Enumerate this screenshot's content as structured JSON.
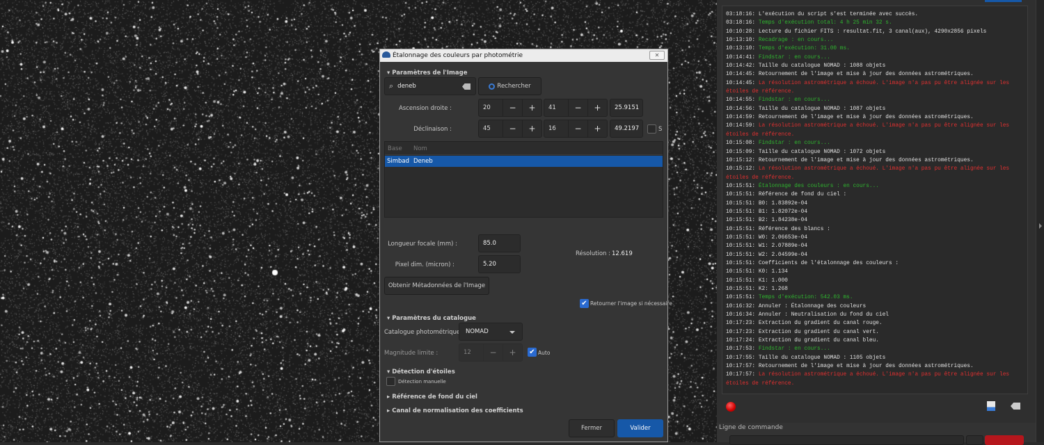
{
  "dialog": {
    "title": "Étalonnage des couleurs par photométrie",
    "close_label": "✕",
    "sec_image": "Paramètres de l'Image",
    "search_value": "deneb",
    "search_button": "Rechercher",
    "ra_label": "Ascension droite :",
    "ra": [
      "20",
      "41",
      "25.9151"
    ],
    "dec_label": "Déclinaison :",
    "dec": [
      "45",
      "16",
      "49.2197"
    ],
    "south_label": "S",
    "south_checked": false,
    "table_headers": [
      "Base",
      "Nom"
    ],
    "table_rows": [
      [
        "Simbad",
        "Deneb"
      ]
    ],
    "focal_label": "Longueur focale (mm) :",
    "focal_value": "85.0",
    "pixel_label": "Pixel dim. (micron) :",
    "pixel_value": "5.20",
    "resolution_label": "Résolution :",
    "resolution_value": "12.619",
    "metadata_button": "Obtenir Métadonnées de l'Image",
    "flip_label": "Retourner l'image si nécessaire",
    "flip_checked": true,
    "sec_catalogue": "Paramètres du catalogue",
    "catalogue_label": "Catalogue photométrique :",
    "catalogue_value": "NOMAD",
    "maglim_label": "Magnitude limite :",
    "maglim_value": "12",
    "auto_label": "Auto",
    "auto_checked": true,
    "sec_detection": "Détection d'étoiles",
    "manual_label": "Détection manuelle",
    "manual_checked": false,
    "sec_background": "Référence de fond du ciel",
    "sec_norm": "Canal de normalisation des coefficients",
    "close_button": "Fermer",
    "apply_button": "Valider"
  },
  "log": [
    {
      "time": "03:18:16:",
      "msg": "L'exécution du script s'est terminée avec succès.",
      "type": "info"
    },
    {
      "time": "03:18:16:",
      "msg": "Temps d'exécution total: 4 h 25 min 32 s.",
      "type": "ok"
    },
    {
      "time": "10:10:28:",
      "msg": "Lecture du fichier FITS : resultat.fit, 3 canal(aux), 4290x2856 pixels",
      "type": "info"
    },
    {
      "time": "10:13:10:",
      "msg": "Recadrage : en cours...",
      "type": "ok"
    },
    {
      "time": "10:13:10:",
      "msg": "Temps d'exécution: 31.00 ms.",
      "type": "ok"
    },
    {
      "time": "10:14:41:",
      "msg": "Findstar : en cours...",
      "type": "ok"
    },
    {
      "time": "10:14:42:",
      "msg": "Taille du catalogue NOMAD : 1088 objets",
      "type": "info"
    },
    {
      "time": "10:14:45:",
      "msg": "Retournement de l'image et mise à jour des données astrométriques.",
      "type": "info"
    },
    {
      "time": "10:14:45:",
      "msg": "La résolution astrométrique a échoué. L'image n'a pas pu être alignée sur les étoiles de référence.",
      "type": "err"
    },
    {
      "time": "10:14:55:",
      "msg": "Findstar : en cours...",
      "type": "ok"
    },
    {
      "time": "10:14:56:",
      "msg": "Taille du catalogue NOMAD : 1087 objets",
      "type": "info"
    },
    {
      "time": "10:14:59:",
      "msg": "Retournement de l'image et mise à jour des données astrométriques.",
      "type": "info"
    },
    {
      "time": "10:14:59:",
      "msg": "La résolution astrométrique a échoué. L'image n'a pas pu être alignée sur les étoiles de référence.",
      "type": "err"
    },
    {
      "time": "10:15:08:",
      "msg": "Findstar : en cours...",
      "type": "ok"
    },
    {
      "time": "10:15:09:",
      "msg": "Taille du catalogue NOMAD : 1072 objets",
      "type": "info"
    },
    {
      "time": "10:15:12:",
      "msg": "Retournement de l'image et mise à jour des données astrométriques.",
      "type": "info"
    },
    {
      "time": "10:15:12:",
      "msg": "La résolution astrométrique a échoué. L'image n'a pas pu être alignée sur les étoiles de référence.",
      "type": "err"
    },
    {
      "time": "10:15:51:",
      "msg": "Étalonnage des couleurs : en cours...",
      "type": "ok"
    },
    {
      "time": "10:15:51:",
      "msg": "Référence de fond du ciel :",
      "type": "info"
    },
    {
      "time": "10:15:51:",
      "msg": "B0: 1.83892e-04",
      "type": "info"
    },
    {
      "time": "10:15:51:",
      "msg": "B1: 1.82072e-04",
      "type": "info"
    },
    {
      "time": "10:15:51:",
      "msg": "B2: 1.84238e-04",
      "type": "info"
    },
    {
      "time": "10:15:51:",
      "msg": "Référence des blancs :",
      "type": "info"
    },
    {
      "time": "10:15:51:",
      "msg": "W0: 2.06653e-04",
      "type": "info"
    },
    {
      "time": "10:15:51:",
      "msg": "W1: 2.07889e-04",
      "type": "info"
    },
    {
      "time": "10:15:51:",
      "msg": "W2: 2.04599e-04",
      "type": "info"
    },
    {
      "time": "10:15:51:",
      "msg": "Coefficients de l'étalonnage des couleurs :",
      "type": "info"
    },
    {
      "time": "10:15:51:",
      "msg": "K0: 1.134",
      "type": "info"
    },
    {
      "time": "10:15:51:",
      "msg": "K1: 1.000",
      "type": "info"
    },
    {
      "time": "10:15:51:",
      "msg": "K2: 1.268",
      "type": "info"
    },
    {
      "time": "10:15:51:",
      "msg": "Temps d'exécution: 542.03 ms.",
      "type": "ok"
    },
    {
      "time": "10:16:32:",
      "msg": "Annuler : Étalonnage des couleurs",
      "type": "info"
    },
    {
      "time": "10:16:34:",
      "msg": "Annuler : Neutralisation du fond du ciel",
      "type": "info"
    },
    {
      "time": "10:17:23:",
      "msg": "Extraction du gradient du canal rouge.",
      "type": "info"
    },
    {
      "time": "10:17:23:",
      "msg": "Extraction du gradient du canal vert.",
      "type": "info"
    },
    {
      "time": "10:17:24:",
      "msg": "Extraction du gradient du canal bleu.",
      "type": "info"
    },
    {
      "time": "10:17:53:",
      "msg": "Findstar : en cours...",
      "type": "ok"
    },
    {
      "time": "10:17:55:",
      "msg": "Taille du catalogue NOMAD : 1105 objets",
      "type": "info"
    },
    {
      "time": "10:17:57:",
      "msg": "Retournement de l'image et mise à jour des données astrométriques.",
      "type": "info"
    },
    {
      "time": "10:17:57:",
      "msg": "La résolution astrométrique a échoué. L'image n'a pas pu être alignée sur les étoiles de référence.",
      "type": "err"
    }
  ],
  "console": {
    "command_label": "Ligne de commande"
  },
  "colors": {
    "accent": "#1658a8",
    "ok": "#2fb52f",
    "err": "#e03030",
    "stop": "#b5161c"
  }
}
